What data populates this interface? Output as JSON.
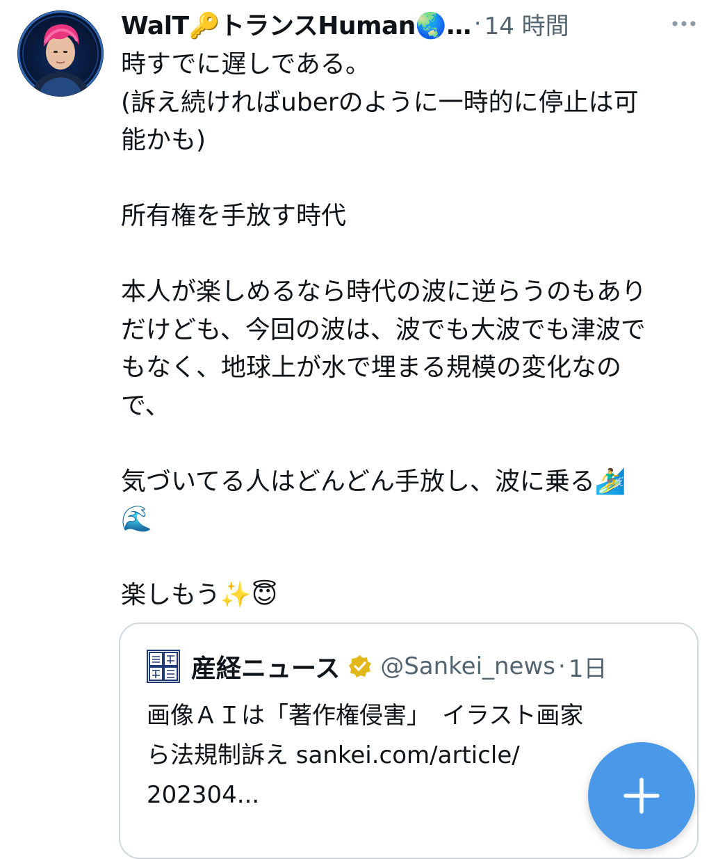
{
  "tweet": {
    "author": {
      "display_name": "WalT🔑トランスHuman🌏…",
      "time": "14 時間",
      "separator": "·"
    },
    "body_lines": [
      "時すでに遅しである。",
      "(訴え続ければuberのように一時的に停止は可",
      "能かも)",
      "",
      "所有権を手放す時代",
      "",
      "本人が楽しめるなら時代の波に逆らうのもあり",
      "だけども、今回の波は、波でも大波でも津波で",
      "もなく、地球上が水で埋まる規模の変化なの",
      "で、",
      "",
      "気づいてる人はどんどん手放し、波に乗る🏄‍♂️",
      "🌊",
      "",
      "楽しもう✨😇"
    ],
    "quote": {
      "name": "産経ニュース",
      "handle": "@Sankei_news",
      "separator": "·",
      "time": "1日",
      "logo_text": "産經新聞",
      "text_lines": [
        "画像ＡＩは「著作権侵害」　イラスト画家",
        "ら法規制訴え sankei.com/article/",
        "202304..."
      ]
    }
  },
  "colors": {
    "text_primary": "#0f1419",
    "text_secondary": "#536471",
    "border": "#cfd9de",
    "fab": "#4a99e9",
    "verified": "#e2b719"
  },
  "icons": {
    "more": "more-horizontal-icon",
    "verified": "verified-badge-icon",
    "compose": "plus-icon"
  }
}
